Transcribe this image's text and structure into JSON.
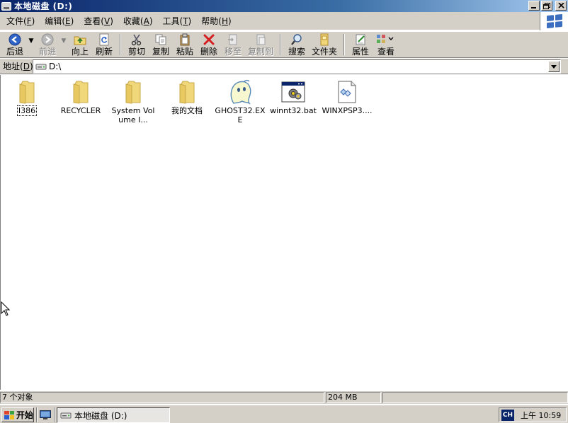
{
  "window": {
    "title": "本地磁盘 (D:)",
    "buttons": {
      "minimize": "_",
      "maximize": "▫",
      "close": "✕"
    }
  },
  "menu": {
    "items": [
      {
        "label": "文件",
        "key": "F"
      },
      {
        "label": "编辑",
        "key": "E"
      },
      {
        "label": "查看",
        "key": "V"
      },
      {
        "label": "收藏",
        "key": "A"
      },
      {
        "label": "工具",
        "key": "T"
      },
      {
        "label": "帮助",
        "key": "H"
      }
    ]
  },
  "toolbar": {
    "back": "后退",
    "forward": "前进",
    "up": "向上",
    "refresh": "刷新",
    "cut": "剪切",
    "copy": "复制",
    "paste": "粘贴",
    "delete": "删除",
    "move_to": "移至",
    "copy_to": "复制到",
    "search": "搜索",
    "folders": "文件夹",
    "properties": "属性",
    "views": "查看"
  },
  "address": {
    "label": "地址",
    "key": "D",
    "value": "D:\\"
  },
  "files": [
    {
      "name": "I386",
      "type": "folder"
    },
    {
      "name": "RECYCLER",
      "type": "folder"
    },
    {
      "name": "System Volume I...",
      "type": "folder"
    },
    {
      "name": "我的文档",
      "type": "folder"
    },
    {
      "name": "GHOST32.EXE",
      "type": "ghost-exe"
    },
    {
      "name": "winnt32.bat",
      "type": "batch"
    },
    {
      "name": "WINXPSP3....",
      "type": "document"
    }
  ],
  "status": {
    "objects": "7 个对象",
    "size": "204 MB"
  },
  "taskbar": {
    "start": "开始",
    "task_title": "本地磁盘 (D:)",
    "ime": "CH",
    "clock": "上午 10:59"
  },
  "colors": {
    "title_gradient_start": "#0a246a",
    "title_gradient_end": "#a6caf0",
    "chrome": "#d4d0c8",
    "folder": "#f0d77a"
  }
}
